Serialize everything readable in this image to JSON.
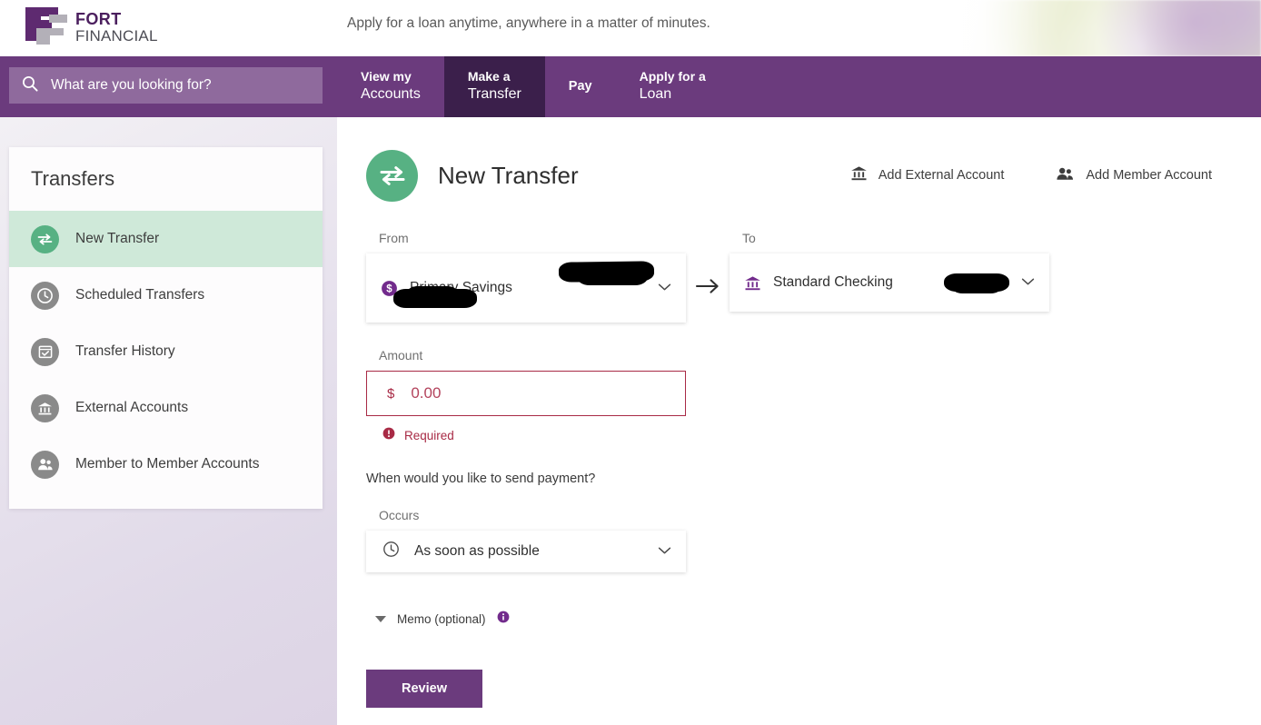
{
  "header": {
    "logo": {
      "line1": "FORT",
      "line2": "FINANCIAL"
    },
    "tagline": "Apply for a loan anytime, anywhere in a matter of minutes."
  },
  "search": {
    "placeholder": "What are you looking for?",
    "value": ""
  },
  "nav": {
    "items": [
      {
        "line1": "View my",
        "line2": "Accounts",
        "active": false
      },
      {
        "line1": "Make a",
        "line2": "Transfer",
        "active": true
      },
      {
        "line1": "Pay",
        "line2": "",
        "active": false
      },
      {
        "line1": "Apply for a",
        "line2": "Loan",
        "active": false
      }
    ]
  },
  "sidebar": {
    "title": "Transfers",
    "items": [
      {
        "label": "New Transfer",
        "icon": "transfer-arrows-icon",
        "active": true
      },
      {
        "label": "Scheduled Transfers",
        "icon": "clock-icon",
        "active": false
      },
      {
        "label": "Transfer History",
        "icon": "calendar-check-icon",
        "active": false
      },
      {
        "label": "External Accounts",
        "icon": "bank-icon",
        "active": false
      },
      {
        "label": "Member to Member Accounts",
        "icon": "people-icon",
        "active": false
      }
    ]
  },
  "main": {
    "page_title": "New Transfer",
    "page_icon": "transfer-arrows-icon",
    "actions": [
      {
        "label": "Add External Account",
        "icon": "bank-icon"
      },
      {
        "label": "Add Member Account",
        "icon": "people-icon"
      }
    ],
    "from": {
      "label": "From",
      "account_name": "Primary Savings",
      "account_number": "",
      "balance": "",
      "icon": "dollar-circle-icon"
    },
    "to": {
      "label": "To",
      "account_name": "Standard Checking",
      "account_number": "",
      "icon": "bank-icon"
    },
    "amount": {
      "label": "Amount",
      "currency_symbol": "$",
      "value": "",
      "placeholder": "0.00",
      "error": "Required",
      "error_color": "#a82a45"
    },
    "schedule": {
      "question": "When would you like to send payment?",
      "occurs_label": "Occurs",
      "occurs_value": "As soon as possible",
      "occurs_icon": "clock-icon"
    },
    "memo": {
      "label": "Memo (optional)",
      "info_icon": "info-icon",
      "expanded": false
    },
    "submit_label": "Review"
  },
  "colors": {
    "brand_purple": "#6b3b7d",
    "nav_active": "#3b1f4b",
    "accent_green": "#57b183",
    "error_red": "#a82a45",
    "sidebar_active": "#cfe9d9"
  }
}
